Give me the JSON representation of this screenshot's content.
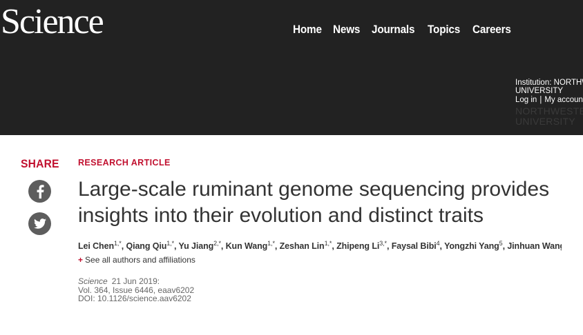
{
  "header": {
    "logo": "Science",
    "nav": [
      "Home",
      "News",
      "Journals",
      "Topics",
      "Careers"
    ],
    "institution_label": "Institution: NORTHWESTERN",
    "institution_label2": "UNIVERSITY",
    "login": "Log in",
    "separator": "|",
    "my_account": "My account",
    "institution_logo_line1": "NORTHWESTERN",
    "institution_logo_line2": "UNIVERSITY"
  },
  "share": {
    "title": "SHARE",
    "facebook_icon": "facebook-icon",
    "twitter_icon": "twitter-icon"
  },
  "article": {
    "type": "RESEARCH ARTICLE",
    "title": "Large-scale ruminant genome sequencing provides insights into their evolution and distinct traits",
    "authors": [
      {
        "name": "Lei Chen",
        "sup": "1,*"
      },
      {
        "name": "Qiang Qiu",
        "sup": "1,*"
      },
      {
        "name": "Yu Jiang",
        "sup": "2,*"
      },
      {
        "name": "Kun Wang",
        "sup": "1,*"
      },
      {
        "name": "Zeshan Lin",
        "sup": "1,*"
      },
      {
        "name": "Zhipeng Li",
        "sup": "3,*"
      },
      {
        "name": "Faysal Bibi",
        "sup": "4"
      },
      {
        "name": "Yongzhi Yang",
        "sup": "5"
      },
      {
        "name": "Jinhuan Wang…",
        "sup": ""
      }
    ],
    "see_all": "See all authors and affiliations",
    "journal": "Science",
    "date": "21 Jun 2019:",
    "volume": "Vol. 364, Issue 6446, eaav6202",
    "doi": "DOI: 10.1126/science.aav6202"
  },
  "colors": {
    "header_bg": "#222222",
    "accent": "#c1102f",
    "share_icon_bg": "#5d5d5d",
    "text": "#333333"
  }
}
